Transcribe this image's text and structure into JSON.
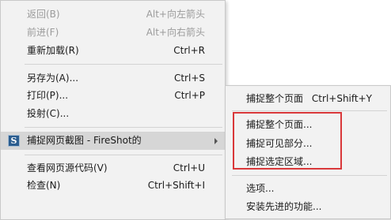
{
  "main_menu": {
    "back": {
      "label": "返回(B)",
      "shortcut": "Alt+向左箭头"
    },
    "forward": {
      "label": "前进(F)",
      "shortcut": "Alt+向右箭头"
    },
    "reload": {
      "label": "重新加载(R)",
      "shortcut": "Ctrl+R"
    },
    "save_as": {
      "label": "另存为(A)...",
      "shortcut": "Ctrl+S"
    },
    "print": {
      "label": "打印(P)...",
      "shortcut": "Ctrl+P"
    },
    "cast": {
      "label": "投射(C)..."
    },
    "fireshot": {
      "label": "捕捉网页截图 - FireShot的",
      "icon": "fireshot-icon",
      "icon_glyph": "S",
      "icon_color": "#2b5d8f"
    },
    "view_source": {
      "label": "查看网页源代码(V)",
      "shortcut": "Ctrl+U"
    },
    "inspect": {
      "label": "检查(N)",
      "shortcut": "Ctrl+Shift+I"
    }
  },
  "submenu": {
    "capture_full": {
      "label": "捕捉整个页面",
      "shortcut": "Ctrl+Shift+Y"
    },
    "capture_full_dialog": {
      "label": "捕捉整个页面..."
    },
    "capture_visible": {
      "label": "捕捉可见部分..."
    },
    "capture_selection": {
      "label": "捕捉选定区域..."
    },
    "options": {
      "label": "选项..."
    },
    "install_advanced": {
      "label": "安装先进的功能..."
    }
  },
  "colors": {
    "menu_background": "#f2f2f2",
    "highlight": "#d6d6d6",
    "disabled_text": "#9b9b9b",
    "annotation_box": "#d9383a"
  }
}
